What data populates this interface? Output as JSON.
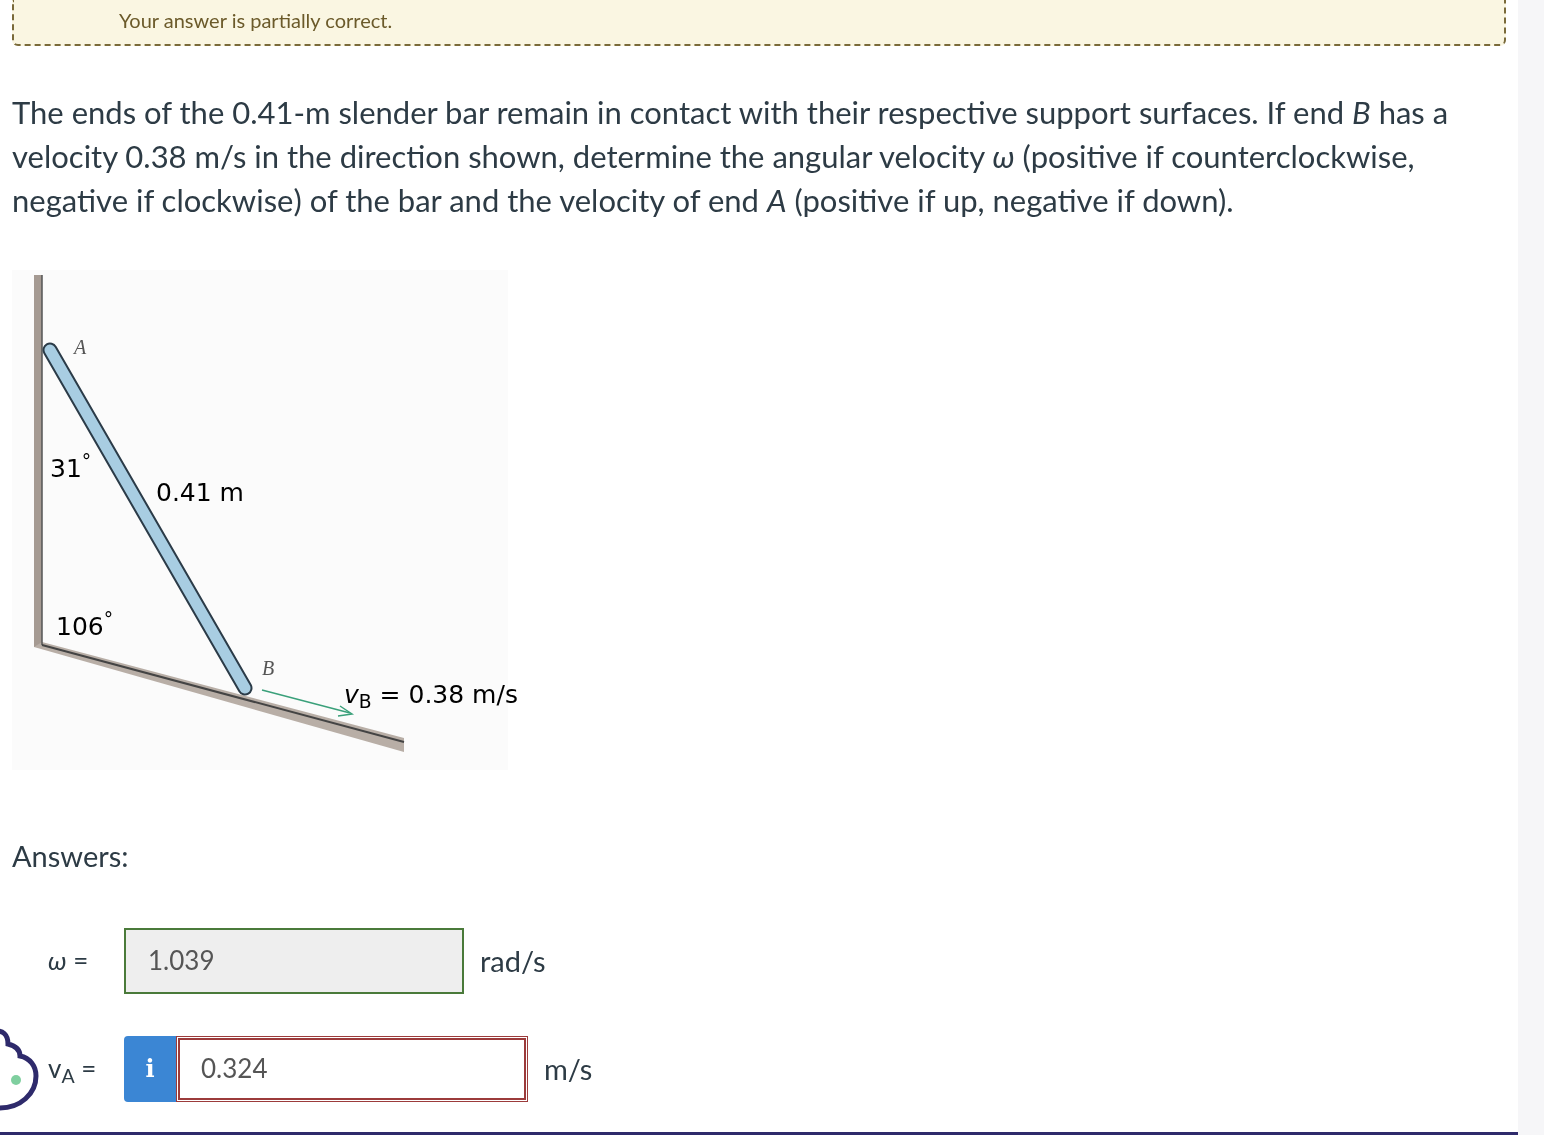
{
  "banner": {
    "text": "Your answer is partially correct."
  },
  "problem": {
    "text": "The ends of the 0.41-m slender bar remain in contact with their respective support surfaces. If end *B* has a velocity 0.38 m/s in the direction shown, determine the angular velocity *ω* (positive if counterclockwise, negative if clockwise) of the bar and the velocity of end *A* (positive if up, negative if down)."
  },
  "figure": {
    "labels": [
      {
        "text": "*A*",
        "kind": "point"
      },
      {
        "text": "31$^{°}$",
        "kind": "dim"
      },
      {
        "text": "0.41 m",
        "kind": "dim"
      },
      {
        "text": "106$^{°}$",
        "kind": "dim"
      },
      {
        "text": "*B*",
        "kind": "point"
      },
      {
        "text": "*v*$_{B}$ = 0.38 m/s",
        "kind": "dim"
      }
    ]
  },
  "answers_heading": "Answers:",
  "answers": [
    {
      "label": "*ω* =",
      "value": "1.039",
      "unit": "rad/s",
      "correct": true
    },
    {
      "label": "v$_{A}$ =",
      "value": "0.324",
      "unit": "m/s",
      "correct": false,
      "info": "i"
    }
  ]
}
